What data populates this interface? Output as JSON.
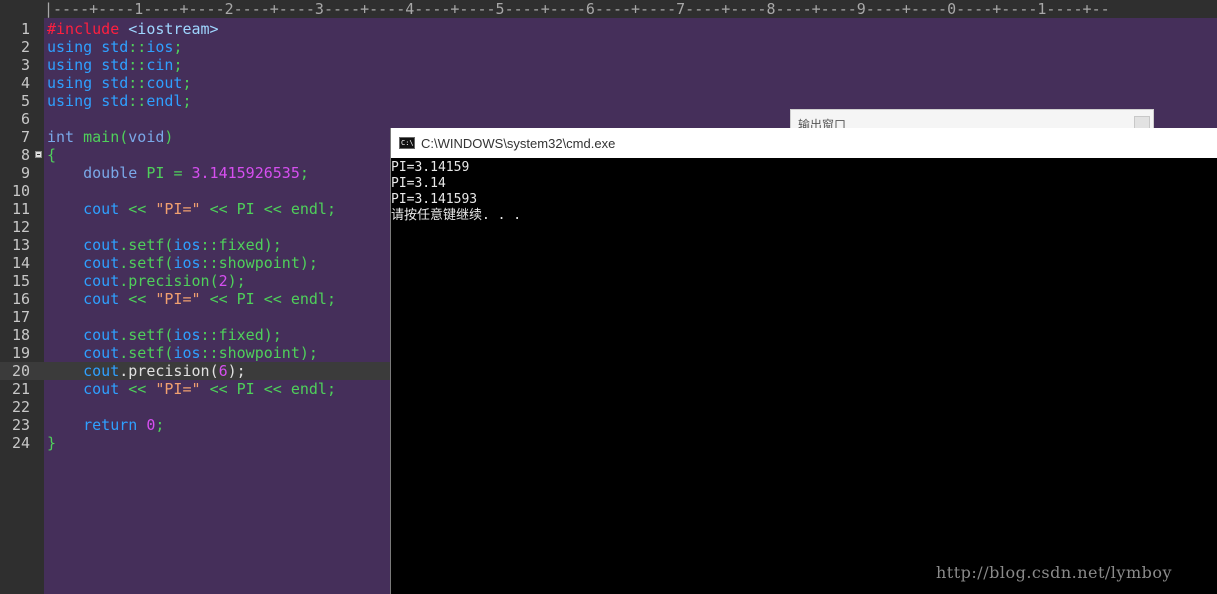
{
  "editor": {
    "ruler": "|----+----1----+----2----+----3----+----4----+----5----+----6----+----7----+----8----+----9----+----0----+----1----+--",
    "current_line": 20,
    "lines": [
      {
        "n": "1",
        "tokens": [
          {
            "c": "pp",
            "t": "#include"
          },
          {
            "c": "pl",
            "t": " "
          },
          {
            "c": "inc",
            "t": "<iostream>"
          }
        ]
      },
      {
        "n": "2",
        "tokens": [
          {
            "c": "kw",
            "t": "using"
          },
          {
            "c": "pl",
            "t": " "
          },
          {
            "c": "kw",
            "t": "std"
          },
          {
            "c": "op",
            "t": "::"
          },
          {
            "c": "kw",
            "t": "ios"
          },
          {
            "c": "op",
            "t": ";"
          }
        ]
      },
      {
        "n": "3",
        "tokens": [
          {
            "c": "kw",
            "t": "using"
          },
          {
            "c": "pl",
            "t": " "
          },
          {
            "c": "kw",
            "t": "std"
          },
          {
            "c": "op",
            "t": "::"
          },
          {
            "c": "kw",
            "t": "cin"
          },
          {
            "c": "op",
            "t": ";"
          }
        ]
      },
      {
        "n": "4",
        "tokens": [
          {
            "c": "kw",
            "t": "using"
          },
          {
            "c": "pl",
            "t": " "
          },
          {
            "c": "kw",
            "t": "std"
          },
          {
            "c": "op",
            "t": "::"
          },
          {
            "c": "kw",
            "t": "cout"
          },
          {
            "c": "op",
            "t": ";"
          }
        ]
      },
      {
        "n": "5",
        "tokens": [
          {
            "c": "kw",
            "t": "using"
          },
          {
            "c": "pl",
            "t": " "
          },
          {
            "c": "kw",
            "t": "std"
          },
          {
            "c": "op",
            "t": "::"
          },
          {
            "c": "kw",
            "t": "endl"
          },
          {
            "c": "op",
            "t": ";"
          }
        ]
      },
      {
        "n": "6",
        "tokens": []
      },
      {
        "n": "7",
        "tokens": [
          {
            "c": "ty",
            "t": "int"
          },
          {
            "c": "pl",
            "t": " "
          },
          {
            "c": "id",
            "t": "main"
          },
          {
            "c": "op",
            "t": "("
          },
          {
            "c": "ty",
            "t": "void"
          },
          {
            "c": "op",
            "t": ")"
          }
        ]
      },
      {
        "n": "8",
        "fold": true,
        "tokens": [
          {
            "c": "op",
            "t": "{"
          }
        ]
      },
      {
        "n": "9",
        "tokens": [
          {
            "c": "pl",
            "t": "    "
          },
          {
            "c": "ty",
            "t": "double"
          },
          {
            "c": "pl",
            "t": " "
          },
          {
            "c": "id",
            "t": "PI"
          },
          {
            "c": "pl",
            "t": " "
          },
          {
            "c": "op",
            "t": "="
          },
          {
            "c": "pl",
            "t": " "
          },
          {
            "c": "num",
            "t": "3.1415926535"
          },
          {
            "c": "op",
            "t": ";"
          }
        ]
      },
      {
        "n": "10",
        "tokens": []
      },
      {
        "n": "11",
        "tokens": [
          {
            "c": "pl",
            "t": "    "
          },
          {
            "c": "kw",
            "t": "cout"
          },
          {
            "c": "pl",
            "t": " "
          },
          {
            "c": "op",
            "t": "<<"
          },
          {
            "c": "pl",
            "t": " "
          },
          {
            "c": "str",
            "t": "\"PI=\""
          },
          {
            "c": "pl",
            "t": " "
          },
          {
            "c": "op",
            "t": "<<"
          },
          {
            "c": "pl",
            "t": " "
          },
          {
            "c": "id",
            "t": "PI"
          },
          {
            "c": "pl",
            "t": " "
          },
          {
            "c": "op",
            "t": "<<"
          },
          {
            "c": "pl",
            "t": " "
          },
          {
            "c": "id",
            "t": "endl"
          },
          {
            "c": "op",
            "t": ";"
          }
        ]
      },
      {
        "n": "12",
        "tokens": []
      },
      {
        "n": "13",
        "tokens": [
          {
            "c": "pl",
            "t": "    "
          },
          {
            "c": "kw",
            "t": "cout"
          },
          {
            "c": "op",
            "t": "."
          },
          {
            "c": "id",
            "t": "setf"
          },
          {
            "c": "op",
            "t": "("
          },
          {
            "c": "kw",
            "t": "ios"
          },
          {
            "c": "op",
            "t": "::"
          },
          {
            "c": "id",
            "t": "fixed"
          },
          {
            "c": "op",
            "t": ");"
          }
        ]
      },
      {
        "n": "14",
        "tokens": [
          {
            "c": "pl",
            "t": "    "
          },
          {
            "c": "kw",
            "t": "cout"
          },
          {
            "c": "op",
            "t": "."
          },
          {
            "c": "id",
            "t": "setf"
          },
          {
            "c": "op",
            "t": "("
          },
          {
            "c": "kw",
            "t": "ios"
          },
          {
            "c": "op",
            "t": "::"
          },
          {
            "c": "id",
            "t": "showpoint"
          },
          {
            "c": "op",
            "t": ");"
          }
        ]
      },
      {
        "n": "15",
        "tokens": [
          {
            "c": "pl",
            "t": "    "
          },
          {
            "c": "kw",
            "t": "cout"
          },
          {
            "c": "op",
            "t": "."
          },
          {
            "c": "id",
            "t": "precision"
          },
          {
            "c": "op",
            "t": "("
          },
          {
            "c": "num",
            "t": "2"
          },
          {
            "c": "op",
            "t": ");"
          }
        ]
      },
      {
        "n": "16",
        "tokens": [
          {
            "c": "pl",
            "t": "    "
          },
          {
            "c": "kw",
            "t": "cout"
          },
          {
            "c": "pl",
            "t": " "
          },
          {
            "c": "op",
            "t": "<<"
          },
          {
            "c": "pl",
            "t": " "
          },
          {
            "c": "str",
            "t": "\"PI=\""
          },
          {
            "c": "pl",
            "t": " "
          },
          {
            "c": "op",
            "t": "<<"
          },
          {
            "c": "pl",
            "t": " "
          },
          {
            "c": "id",
            "t": "PI"
          },
          {
            "c": "pl",
            "t": " "
          },
          {
            "c": "op",
            "t": "<<"
          },
          {
            "c": "pl",
            "t": " "
          },
          {
            "c": "id",
            "t": "endl"
          },
          {
            "c": "op",
            "t": ";"
          }
        ]
      },
      {
        "n": "17",
        "tokens": []
      },
      {
        "n": "18",
        "tokens": [
          {
            "c": "pl",
            "t": "    "
          },
          {
            "c": "kw",
            "t": "cout"
          },
          {
            "c": "op",
            "t": "."
          },
          {
            "c": "id",
            "t": "setf"
          },
          {
            "c": "op",
            "t": "("
          },
          {
            "c": "kw",
            "t": "ios"
          },
          {
            "c": "op",
            "t": "::"
          },
          {
            "c": "id",
            "t": "fixed"
          },
          {
            "c": "op",
            "t": ");"
          }
        ]
      },
      {
        "n": "19",
        "tokens": [
          {
            "c": "pl",
            "t": "    "
          },
          {
            "c": "kw",
            "t": "cout"
          },
          {
            "c": "op",
            "t": "."
          },
          {
            "c": "id",
            "t": "setf"
          },
          {
            "c": "op",
            "t": "("
          },
          {
            "c": "kw",
            "t": "ios"
          },
          {
            "c": "op",
            "t": "::"
          },
          {
            "c": "id",
            "t": "showpoint"
          },
          {
            "c": "op",
            "t": ");"
          }
        ]
      },
      {
        "n": "20",
        "tokens": [
          {
            "c": "pl",
            "t": "    "
          },
          {
            "c": "kw",
            "t": "cout"
          },
          {
            "c": "pl",
            "t": "."
          },
          {
            "c": "pl",
            "t": "precision"
          },
          {
            "c": "pl",
            "t": "("
          },
          {
            "c": "num",
            "t": "6"
          },
          {
            "c": "pl",
            "t": ");"
          }
        ]
      },
      {
        "n": "21",
        "tokens": [
          {
            "c": "pl",
            "t": "    "
          },
          {
            "c": "kw",
            "t": "cout"
          },
          {
            "c": "pl",
            "t": " "
          },
          {
            "c": "op",
            "t": "<<"
          },
          {
            "c": "pl",
            "t": " "
          },
          {
            "c": "str",
            "t": "\"PI=\""
          },
          {
            "c": "pl",
            "t": " "
          },
          {
            "c": "op",
            "t": "<<"
          },
          {
            "c": "pl",
            "t": " "
          },
          {
            "c": "id",
            "t": "PI"
          },
          {
            "c": "pl",
            "t": " "
          },
          {
            "c": "op",
            "t": "<<"
          },
          {
            "c": "pl",
            "t": " "
          },
          {
            "c": "id",
            "t": "endl"
          },
          {
            "c": "op",
            "t": ";"
          }
        ]
      },
      {
        "n": "22",
        "tokens": []
      },
      {
        "n": "23",
        "tokens": [
          {
            "c": "pl",
            "t": "    "
          },
          {
            "c": "kw",
            "t": "return"
          },
          {
            "c": "pl",
            "t": " "
          },
          {
            "c": "num",
            "t": "0"
          },
          {
            "c": "op",
            "t": ";"
          }
        ]
      },
      {
        "n": "24",
        "tokens": [
          {
            "c": "op",
            "t": "}"
          }
        ]
      }
    ]
  },
  "output_window": {
    "title": "输出窗口"
  },
  "cmd": {
    "title": "C:\\WINDOWS\\system32\\cmd.exe",
    "icon_text": "C:\\",
    "lines": [
      "PI=3.14159",
      "PI=3.14",
      "PI=3.141593",
      "请按任意键继续. . ."
    ]
  },
  "watermark": "http://blog.csdn.net/lymboy",
  "colors": {
    "editor_bg": "#452f5a",
    "gutter_bg": "#2f2f2f",
    "preprocessor": "#ff1f3f",
    "keyword": "#2fa0ff",
    "identifier": "#4fd05a",
    "string": "#f0a070",
    "number": "#d64ff0"
  }
}
